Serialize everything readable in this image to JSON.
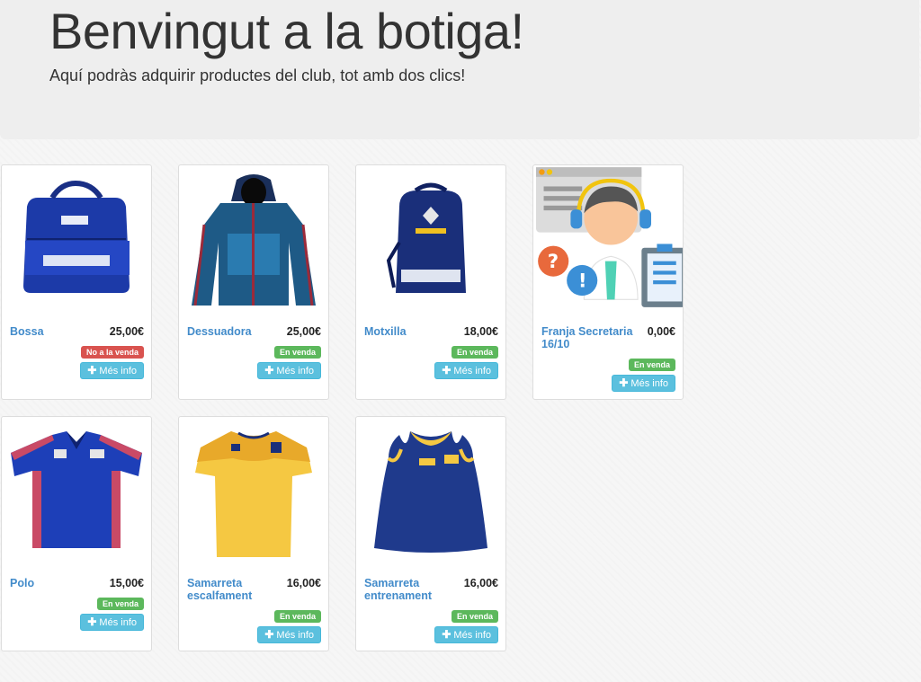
{
  "header": {
    "title": "Benvingut a la botiga!",
    "subtitle": "Aquí podràs adquirir productes del club, tot amb dos clics!"
  },
  "products": [
    {
      "name": "Bossa",
      "price": "25,00€",
      "status": "No a la venda",
      "status_color": "#d9534f",
      "button": "Més info",
      "icon": "plus-icon"
    },
    {
      "name": "Dessuadora",
      "price": "25,00€",
      "status": "En venda",
      "status_color": "#5cb85c",
      "button": "Més info",
      "icon": "plus-icon"
    },
    {
      "name": "Motxilla",
      "price": "18,00€",
      "status": "En venda",
      "status_color": "#5cb85c",
      "button": "Més info",
      "icon": "plus-icon"
    },
    {
      "name": "Franja Secretaria 16/10",
      "price": "0,00€",
      "status": "En venda",
      "status_color": "#5cb85c",
      "button": "Més info",
      "icon": "plus-icon"
    },
    {
      "name": "Polo",
      "price": "15,00€",
      "status": "En venda",
      "status_color": "#5cb85c",
      "button": "Més info",
      "icon": "plus-icon"
    },
    {
      "name": "Samarreta escalfament",
      "price": "16,00€",
      "status": "En venda",
      "status_color": "#5cb85c",
      "button": "Més info",
      "icon": "plus-icon"
    },
    {
      "name": "Samarreta entrenament",
      "price": "16,00€",
      "status": "En venda",
      "status_color": "#5cb85c",
      "button": "Més info",
      "icon": "plus-icon"
    }
  ],
  "colors": {
    "link": "#428bca",
    "info": "#5bc0de"
  }
}
